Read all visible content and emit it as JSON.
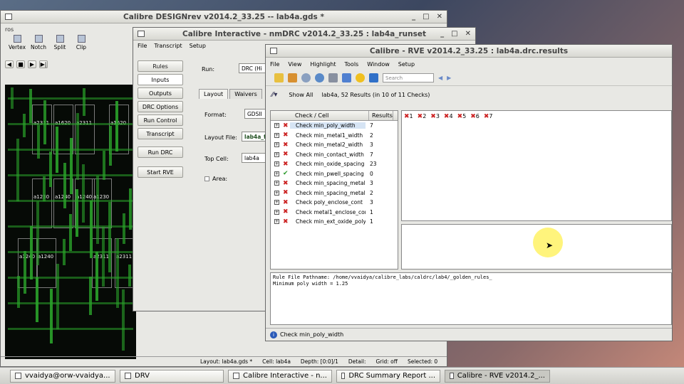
{
  "designrev": {
    "title": "Calibre DESIGNrev v2014.2_33.25  --  lab4a.gds *",
    "menu_fragment": "ros",
    "tools": [
      {
        "label": "Vertex"
      },
      {
        "label": "Notch"
      },
      {
        "label": "Split"
      },
      {
        "label": "Clip"
      }
    ],
    "cells": [
      "a2311",
      "a1620",
      "a2311",
      "a1620",
      "a1230",
      "a1240",
      "a1240",
      "a1230",
      "a1240",
      "a1240",
      "a2311",
      "a2311"
    ],
    "status": {
      "layout": "Layout: lab4a.gds *",
      "cell": "Cell: lab4a",
      "depth": "Depth: [0:0]/1",
      "detail": "Detail:",
      "grid": "Grid: off",
      "selected": "Selected: 0"
    }
  },
  "interactive": {
    "title": "Calibre Interactive - nmDRC v2014.2_33.25 : lab4a_runset",
    "menu": [
      "File",
      "Transcript",
      "Setup"
    ],
    "side_buttons": [
      "Rules",
      "Inputs",
      "Outputs",
      "DRC Options",
      "Run Control",
      "Transcript"
    ],
    "run_drc": "Run DRC",
    "start_rve": "Start RVE",
    "run_label": "Run:",
    "run_value": "DRC (Hi",
    "tabs": [
      "Layout",
      "Waivers"
    ],
    "format_label": "Format:",
    "format_value": "GDSII",
    "layout_file_label": "Layout File:",
    "layout_file_value": "lab4a_fi",
    "top_cell_label": "Top Cell:",
    "top_cell_value": "lab4a",
    "area_label": "Area:"
  },
  "rve": {
    "title": "Calibre - RVE v2014.2_33.25 : lab4a.drc.results",
    "menu": [
      "File",
      "View",
      "Highlight",
      "Tools",
      "Window",
      "Setup"
    ],
    "search_placeholder": "Search",
    "show_all": "Show All",
    "summary": "lab4a, 52 Results (in 10 of 11 Checks)",
    "col_check": "Check / Cell",
    "col_results": "Results",
    "checks": [
      {
        "name": "Check min_poly_width",
        "count": "7",
        "ok": false
      },
      {
        "name": "Check min_metal1_width",
        "count": "2",
        "ok": false
      },
      {
        "name": "Check min_metal2_width",
        "count": "3",
        "ok": false
      },
      {
        "name": "Check min_contact_width",
        "count": "7",
        "ok": false
      },
      {
        "name": "Check min_oxide_spacing",
        "count": "23",
        "ok": false
      },
      {
        "name": "Check min_pwell_spacing",
        "count": "0",
        "ok": true
      },
      {
        "name": "Check min_spacing_metal1",
        "count": "3",
        "ok": false
      },
      {
        "name": "Check min_spacing_metal2",
        "count": "2",
        "ok": false
      },
      {
        "name": "Check poly_enclose_cont",
        "count": "3",
        "ok": false
      },
      {
        "name": "Check metal1_enclose_cont",
        "count": "1",
        "ok": false
      },
      {
        "name": "Check min_ext_oxide_poly",
        "count": "1",
        "ok": false
      }
    ],
    "results": [
      "1",
      "2",
      "3",
      "4",
      "5",
      "6",
      "7"
    ],
    "rule_lines": [
      "Rule File Pathname: /home/vvaidya/calibre_labs/caldrc/lab4/_golden_rules_",
      "Minimum poly width = 1.25"
    ],
    "status": "Check min_poly_width"
  },
  "taskbar": [
    {
      "label": "vvaidya@orw-vvaidya..."
    },
    {
      "label": "DRV"
    },
    {
      "label": "Calibre Interactive - n..."
    },
    {
      "label": "DRC Summary Report ..."
    },
    {
      "label": "Calibre - RVE v2014.2_..."
    }
  ],
  "colors": {
    "error": "#cc2222",
    "ok": "#2a9a2a",
    "layout_bg": "#060a06",
    "layout_stripe": "#2aa22a",
    "highlight": "#ffee55"
  }
}
